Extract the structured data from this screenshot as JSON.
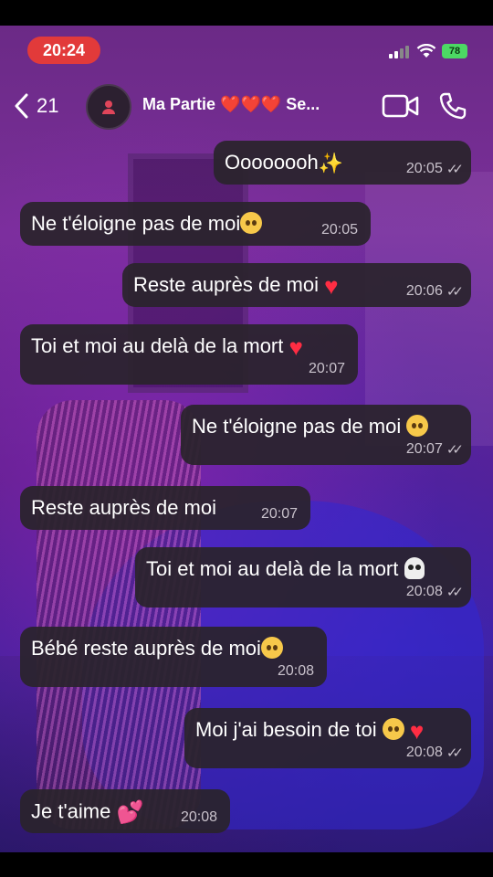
{
  "status_bar": {
    "time": "20:24",
    "battery": "78"
  },
  "header": {
    "back_count": "21",
    "chat_title": "Ma Partie ❤️❤️❤️ Se..."
  },
  "messages": [
    {
      "text": "Oooooooh",
      "emoji": "sparkles",
      "time": "20:05",
      "direction": "outgoing",
      "read": true
    },
    {
      "text": "Ne t'éloigne pas de moi",
      "emoji": "pleading-face",
      "time": "20:05",
      "direction": "incoming"
    },
    {
      "text": "Reste auprès de moi",
      "emoji": "red-heart",
      "time": "20:06",
      "direction": "outgoing",
      "read": true
    },
    {
      "text": "Toi et moi au delà de la mort",
      "emoji": "red-heart",
      "time": "20:07",
      "direction": "incoming"
    },
    {
      "text": "Ne t'éloigne pas de moi",
      "emoji": "pensive-face",
      "time": "20:07",
      "direction": "outgoing",
      "read": true
    },
    {
      "text": "Reste auprès de moi",
      "emoji": "",
      "time": "20:07",
      "direction": "incoming"
    },
    {
      "text": "Toi et moi au delà de la mort",
      "emoji": "skull",
      "time": "20:08",
      "direction": "outgoing",
      "read": true
    },
    {
      "text": "Bébé reste auprès de moi",
      "emoji": "pleading-face",
      "time": "20:08",
      "direction": "incoming"
    },
    {
      "text": "Moi j'ai besoin de toi",
      "emoji": "pensive-face red-heart",
      "time": "20:08",
      "direction": "outgoing",
      "read": true
    },
    {
      "text": "Je t'aime",
      "emoji": "two-hearts",
      "time": "20:08",
      "direction": "incoming"
    }
  ],
  "colors": {
    "bubble": "#2a242c",
    "time_pill": "#e23a3a",
    "battery": "#4cd964",
    "heart": "#ff2d43"
  }
}
